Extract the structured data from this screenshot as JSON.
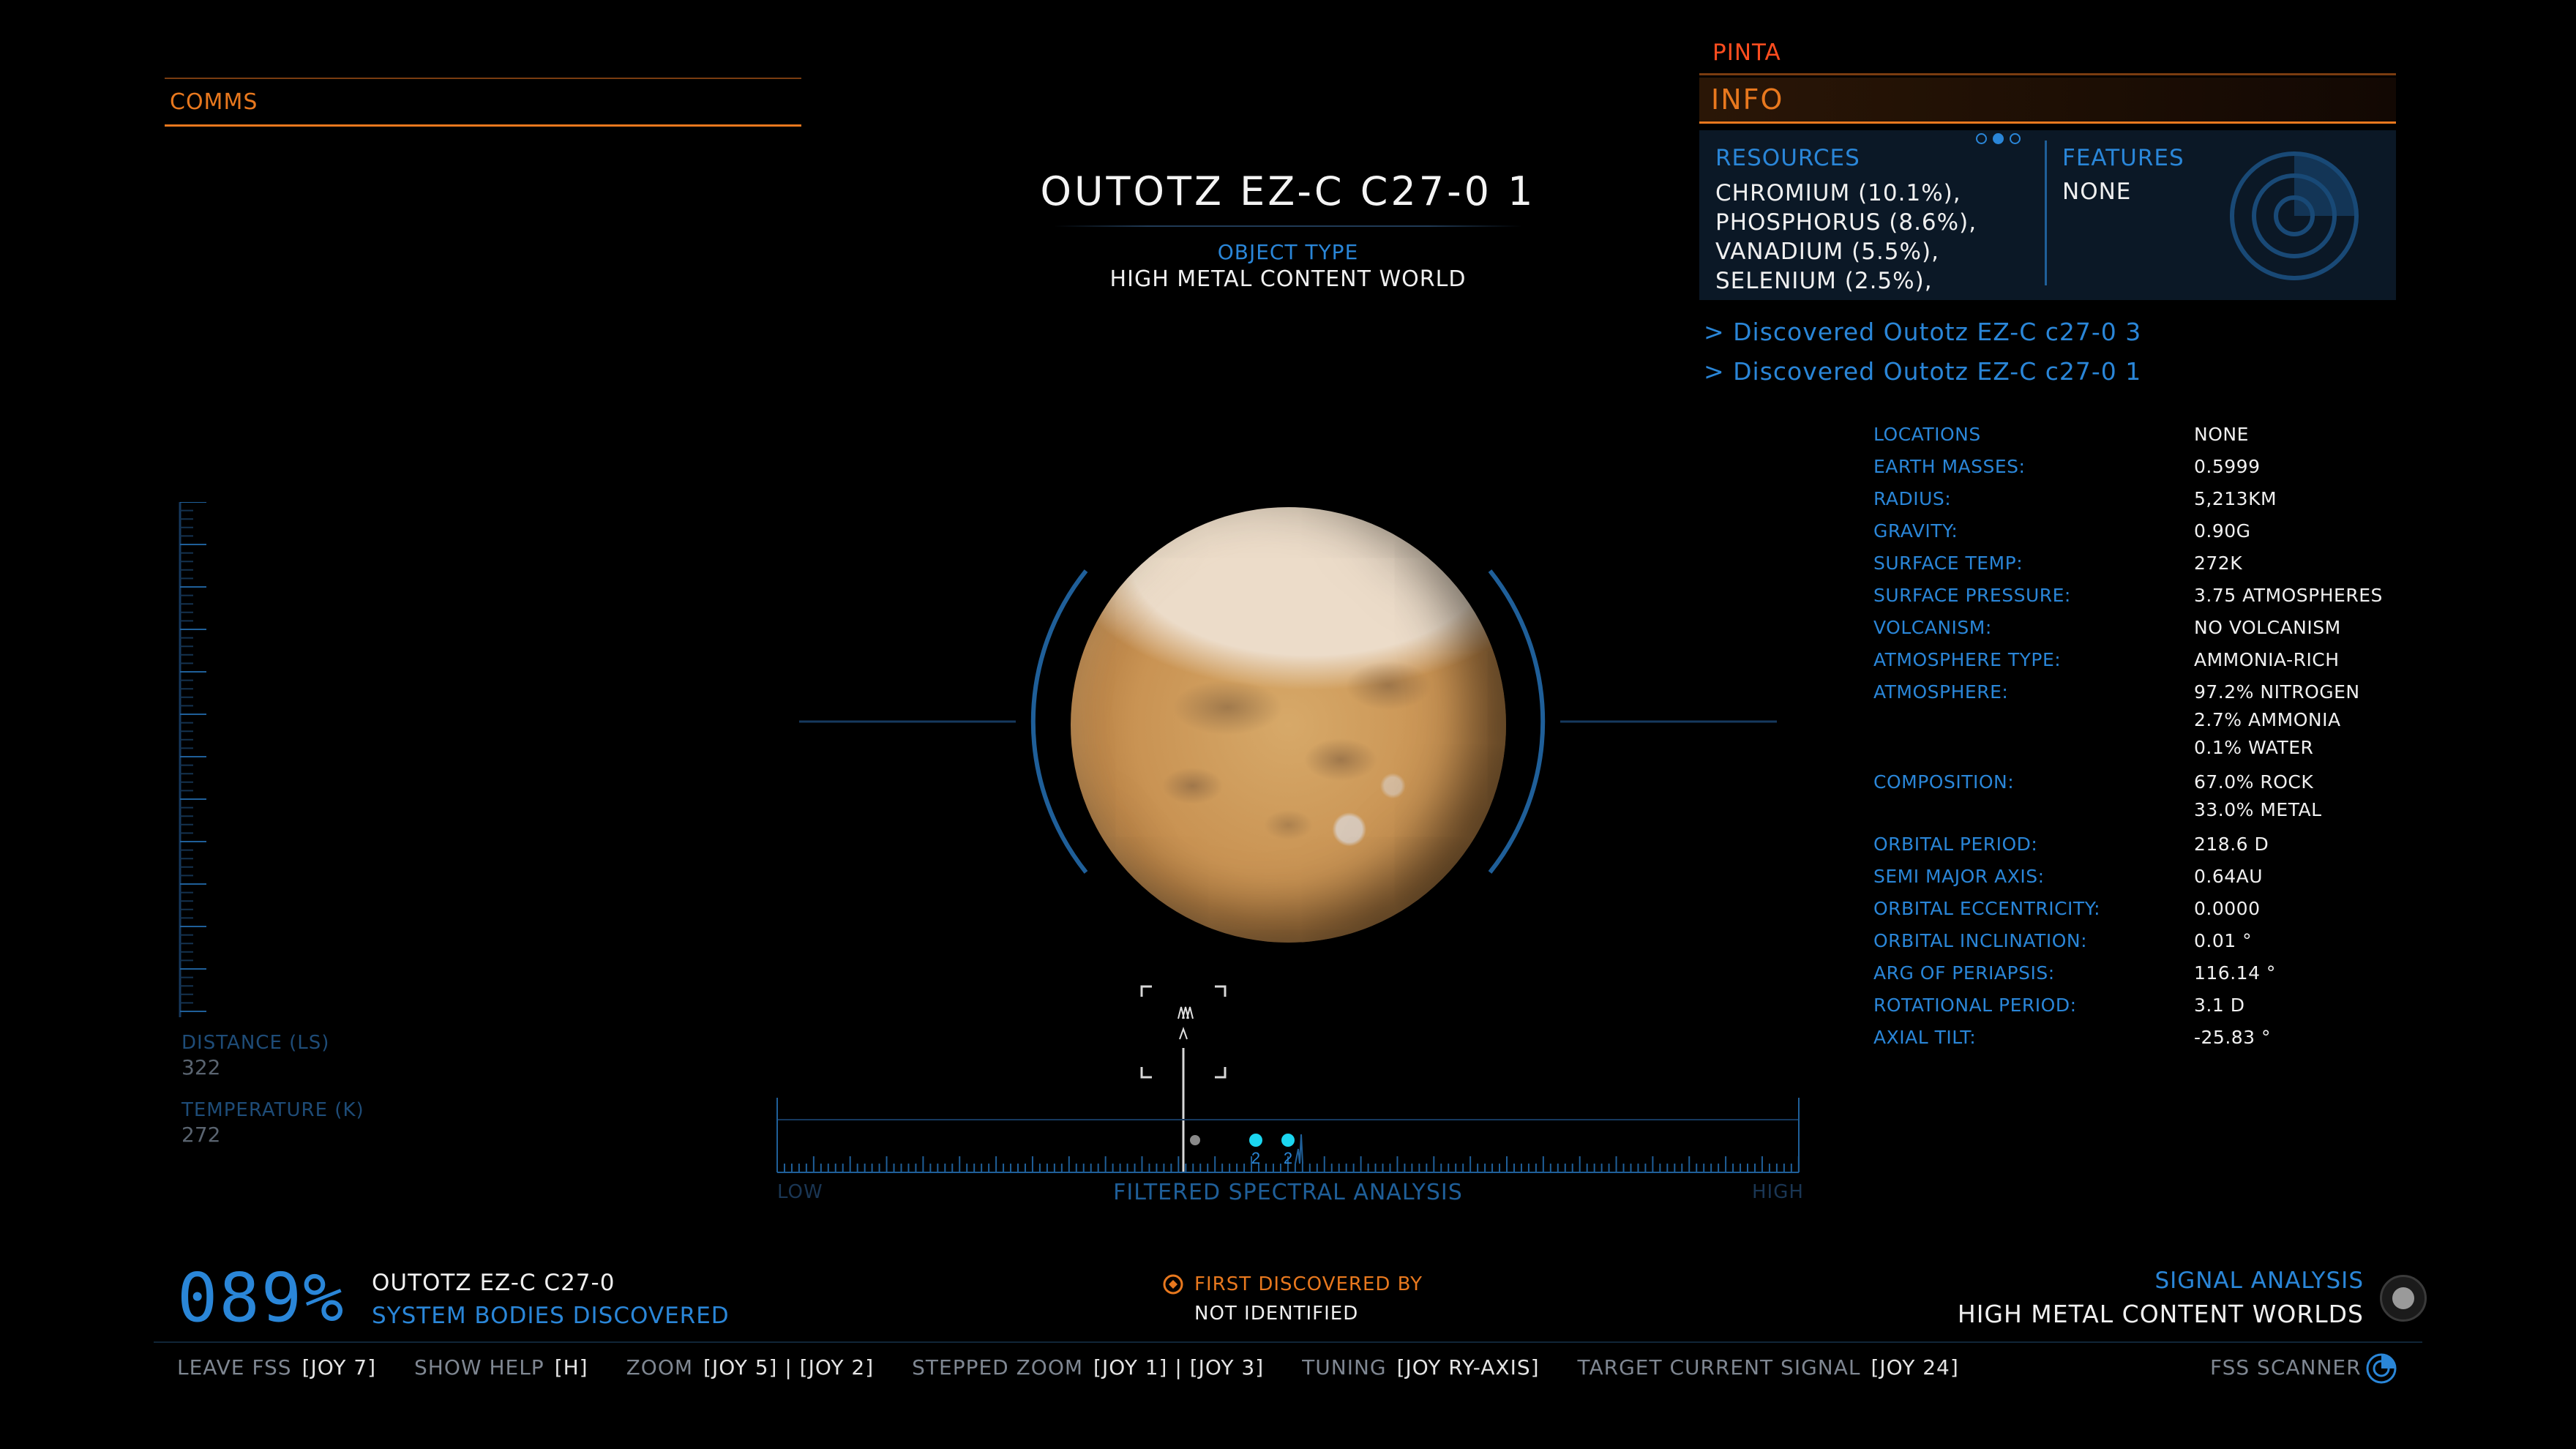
{
  "comms": {
    "label": "COMMS"
  },
  "body": {
    "title": "OUTOTZ EZ-C C27-0 1",
    "object_type_label": "OBJECT TYPE",
    "object_type_value": "HIGH METAL CONTENT WORLD"
  },
  "gauge": {
    "distance_label": "DISTANCE (LS)",
    "distance_value": "322",
    "temperature_label": "TEMPERATURE (K)",
    "temperature_value": "272"
  },
  "ship_name": "PINTA",
  "info": {
    "header": "INFO",
    "pages_total": 3,
    "page_active": 2,
    "resources_label": "RESOURCES",
    "resources": [
      "CHROMIUM (10.1%),",
      "PHOSPHORUS (8.6%),",
      "VANADIUM (5.5%),",
      "SELENIUM (2.5%),"
    ],
    "features_label": "FEATURES",
    "features_value": "NONE",
    "discovered": [
      "> Discovered Outotz EZ-C c27-0 3",
      "> Discovered Outotz EZ-C c27-0 1"
    ]
  },
  "stats": [
    {
      "key": "LOCATIONS",
      "value": "NONE"
    },
    {
      "key": "EARTH MASSES:",
      "value": "0.5999"
    },
    {
      "key": "RADIUS:",
      "value": "5,213KM"
    },
    {
      "key": "GRAVITY:",
      "value": "0.90G"
    },
    {
      "key": "SURFACE TEMP:",
      "value": "272K"
    },
    {
      "key": "SURFACE PRESSURE:",
      "value": "3.75 ATMOSPHERES"
    },
    {
      "key": "VOLCANISM:",
      "value": "NO VOLCANISM"
    },
    {
      "key": "ATMOSPHERE TYPE:",
      "value": "AMMONIA-RICH"
    },
    {
      "key": "ATMOSPHERE:",
      "values": [
        "97.2% NITROGEN",
        "2.7% AMMONIA",
        "0.1% WATER"
      ]
    },
    {
      "key": "COMPOSITION:",
      "values": [
        "67.0% ROCK",
        "33.0% METAL"
      ]
    },
    {
      "key": "ORBITAL PERIOD:",
      "value": "218.6 D"
    },
    {
      "key": "SEMI MAJOR AXIS:",
      "value": "0.64AU"
    },
    {
      "key": "ORBITAL ECCENTRICITY:",
      "value": "0.0000"
    },
    {
      "key": "ORBITAL INCLINATION:",
      "value": "0.01 °"
    },
    {
      "key": "ARG OF PERIAPSIS:",
      "value": "116.14 °"
    },
    {
      "key": "ROTATIONAL PERIOD:",
      "value": "3.1 D"
    },
    {
      "key": "AXIAL TILT:",
      "value": "-25.83 °"
    }
  ],
  "spectral": {
    "title": "FILTERED SPECTRAL ANALYSIS",
    "low_label": "LOW",
    "high_label": "HIGH",
    "signal_counts": [
      "2",
      "2"
    ]
  },
  "progress": {
    "value": "089%",
    "system_name": "OUTOTZ EZ-C C27-0",
    "caption": "SYSTEM BODIES DISCOVERED"
  },
  "first_discovered": {
    "label": "FIRST DISCOVERED BY",
    "value": "NOT IDENTIFIED"
  },
  "signal": {
    "label": "SIGNAL ANALYSIS",
    "value": "HIGH METAL CONTENT WORLDS"
  },
  "controls": [
    {
      "key": "LEAVE FSS",
      "value": "[JOY 7]"
    },
    {
      "key": "SHOW HELP",
      "value": "[H]"
    },
    {
      "key": "ZOOM",
      "value": "[JOY 5] | [JOY 2]"
    },
    {
      "key": "STEPPED ZOOM",
      "value": "[JOY 1] | [JOY 3]"
    },
    {
      "key": "TUNING",
      "value": "[JOY RY-AXIS]"
    },
    {
      "key": "TARGET CURRENT SIGNAL",
      "value": "[JOY 24]"
    }
  ],
  "fss_label": "FSS SCANNER",
  "colors": {
    "accent_orange": "#e8781e",
    "accent_blue": "#2a86d8",
    "ship_red": "#ff4d1f",
    "background": "#000000"
  }
}
